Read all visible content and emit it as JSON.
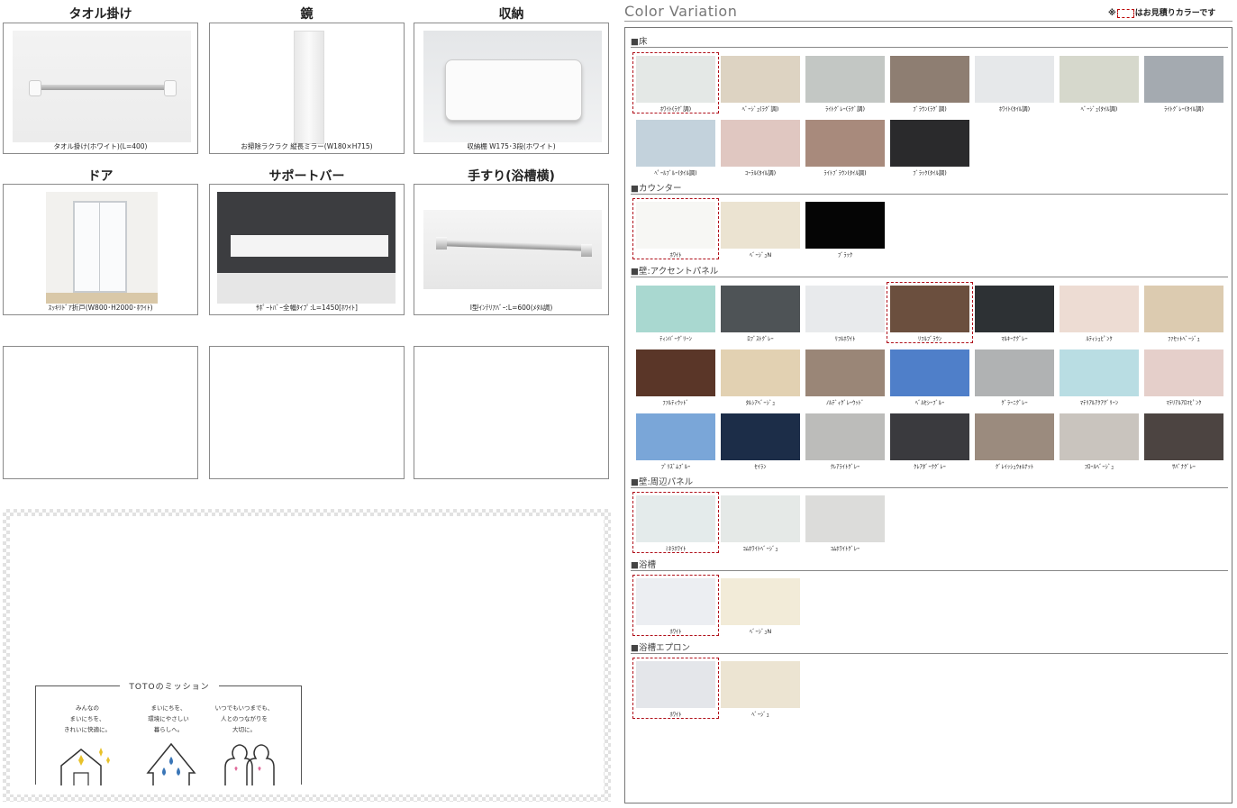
{
  "products": {
    "row1": [
      {
        "title": "タオル掛け",
        "caption": "タオル掛け(ホワイト)(L=400)"
      },
      {
        "title": "鏡",
        "caption": "お掃除ラクラク 縦長ミラー(W180×H715)"
      },
      {
        "title": "収納",
        "caption": "収納棚 W175･3段(ホワイト)"
      }
    ],
    "row2": [
      {
        "title": "ドア",
        "caption": "ｽｯｷﾘﾄﾞｱ折戸(W800･H2000･ﾎﾜｲﾄ)"
      },
      {
        "title": "サポートバー",
        "caption": "ｻﾎﾟｰﾄﾊﾞｰ全幅ﾀｲﾌﾟ:L=1450[ﾎﾜｲﾄ]"
      },
      {
        "title": "手すり(浴槽横)",
        "caption": "I型ｲﾝﾃﾘｱﾊﾞｰ:L=600(ﾒﾀﾙ調)"
      }
    ]
  },
  "mission": {
    "title": "TOTOのミッション",
    "items": [
      {
        "l1": "みんなの",
        "l2": "まいにちを、",
        "l3": "きれいに快適に。"
      },
      {
        "l1": "まいにちを、",
        "l2": "環境にやさしい",
        "l3": "暮らしへ。"
      },
      {
        "l1": "いつでもいつまでも、",
        "l2": "人とのつながりを",
        "l3": "大切に。"
      }
    ]
  },
  "color_variation": {
    "title": "Color Variation",
    "note_prefix": "※",
    "note_suffix": "はお見積りカラーです",
    "sections": [
      {
        "name": "■床",
        "swatches": [
          {
            "label": "ﾎﾜｲﾄ(ﾗｸﾞ調)",
            "color": "#e4e8e6",
            "selected": true
          },
          {
            "label": "ﾍﾞｰｼﾞｭ(ﾗｸﾞ調)",
            "color": "#ddd3c2"
          },
          {
            "label": "ﾗｲﾄｸﾞﾚｰ(ﾗｸﾞ調)",
            "color": "#c3c7c4"
          },
          {
            "label": "ﾌﾞﾗｳﾝ(ﾗｸﾞ調)",
            "color": "#8e7e72"
          },
          {
            "label": "ﾎﾜｲﾄ(ﾀｲﾙ調)",
            "color": "#e6e8ea"
          },
          {
            "label": "ﾍﾞｰｼﾞｭ(ﾀｲﾙ調)",
            "color": "#d6d8cc"
          },
          {
            "label": "ﾗｲﾄｸﾞﾚｰ(ﾀｲﾙ調)",
            "color": "#a4aab0"
          },
          {
            "label": "ﾍﾟｰﾙﾌﾞﾙｰ(ﾀｲﾙ調)",
            "color": "#c3d2dc"
          },
          {
            "label": "ｺｰﾗﾙ(ﾀｲﾙ調)",
            "color": "#e0c7c1"
          },
          {
            "label": "ﾗｲﾄﾌﾞﾗｳﾝ(ﾀｲﾙ調)",
            "color": "#a88a7c"
          },
          {
            "label": "ﾌﾞﾗｯｸ(ﾀｲﾙ調)",
            "color": "#2a2a2c"
          }
        ]
      },
      {
        "name": "■カウンター",
        "swatches": [
          {
            "label": "ﾎﾜｲﾄ",
            "color": "#f7f7f4",
            "selected": true
          },
          {
            "label": "ﾍﾞｰｼﾞｭN",
            "color": "#ebe3d1"
          },
          {
            "label": "ﾌﾞﾗｯｸ",
            "color": "#050505"
          }
        ]
      },
      {
        "name": "■壁:アクセントパネル",
        "swatches": [
          {
            "label": "ﾃｨﾝﾊﾞｰｸﾞﾘｰﾝ",
            "color": "#a9d8d0"
          },
          {
            "label": "ﾛﾌﾞｽﾄｸﾞﾚｰ",
            "color": "#4e5356"
          },
          {
            "label": "ﾘﾌﾙﾎﾜｲﾄ",
            "color": "#e8eaec"
          },
          {
            "label": "ﾘﾌﾙﾌﾞﾗｳﾝ",
            "color": "#6b4f3e",
            "selected": true
          },
          {
            "label": "ﾏﾙｷｰﾅｸﾞﾚｰ",
            "color": "#2d3134"
          },
          {
            "label": "ﾙﾃｨｼｭﾋﾟﾝｸ",
            "color": "#eddcd3"
          },
          {
            "label": "ﾌｧｾｯﾄﾍﾞｰｼﾞｭ",
            "color": "#dccbb0"
          },
          {
            "label": "ﾌｧﾙﾃｨｳｯﾄﾞ",
            "color": "#5a3628"
          },
          {
            "label": "ﾀﾙｼｱﾍﾞｰｼﾞｭ",
            "color": "#e2d1b2"
          },
          {
            "label": "ﾉﾙﾃﾞｨｸﾞﾚｰｳｯﾄﾞ",
            "color": "#9a8677"
          },
          {
            "label": "ﾍﾞﾙｾｼｰﾌﾞﾙｰ",
            "color": "#4f7fc9"
          },
          {
            "label": "ｸﾞﾗｰﾆｸﾞﾚｰ",
            "color": "#b0b2b3"
          },
          {
            "label": "ﾏﾃﾘｱﾙｱｸｱｸﾞﾘｰﾝ",
            "color": "#b9dde3"
          },
          {
            "label": "ﾏﾃﾘｱﾙｱﾛﾏﾋﾟﾝｸ",
            "color": "#e5cfca"
          },
          {
            "label": "ﾌﾟﾘｽﾞﾑﾌﾞﾙｰ",
            "color": "#7aa6d8"
          },
          {
            "label": "ｾｲﾗﾝ",
            "color": "#1c2d48"
          },
          {
            "label": "ｸﾚｱﾗｲﾄｸﾞﾚｰ",
            "color": "#bcbcba"
          },
          {
            "label": "ｸﾚｱﾀﾞｰｸｸﾞﾚｰ",
            "color": "#3a3a3e"
          },
          {
            "label": "ｸﾞﾚｲｯｼｭｳｫﾙﾅｯﾄ",
            "color": "#9b8b7e"
          },
          {
            "label": "ﾌﾛｰﾙﾍﾞｰｼﾞｭ",
            "color": "#c9c4be"
          },
          {
            "label": "ｻﾊﾞﾅｸﾞﾚｰ",
            "color": "#4c4441"
          }
        ]
      },
      {
        "name": "■壁:周辺パネル",
        "swatches": [
          {
            "label": "ﾐﾈﾗﾎﾜｲﾄ",
            "color": "#e4ebeb",
            "selected": true
          },
          {
            "label": "ｺﾑﾎﾜｲﾄﾍﾞｰｼﾞｭ",
            "color": "#e5e9e7"
          },
          {
            "label": "ｺﾑﾎﾜｲﾄｸﾞﾚｰ",
            "color": "#dcdcda"
          }
        ]
      },
      {
        "name": "■浴槽",
        "swatches": [
          {
            "label": "ﾎﾜｲﾄ",
            "color": "#eceef2",
            "selected": true
          },
          {
            "label": "ﾍﾞｰｼﾞｭN",
            "color": "#f2ebd8"
          }
        ]
      },
      {
        "name": "■浴槽エプロン",
        "swatches": [
          {
            "label": "ﾎﾜｲﾄ",
            "color": "#e4e6ea",
            "selected": true
          },
          {
            "label": "ﾍﾞｰｼﾞｭ",
            "color": "#ece4d2"
          }
        ]
      }
    ]
  }
}
